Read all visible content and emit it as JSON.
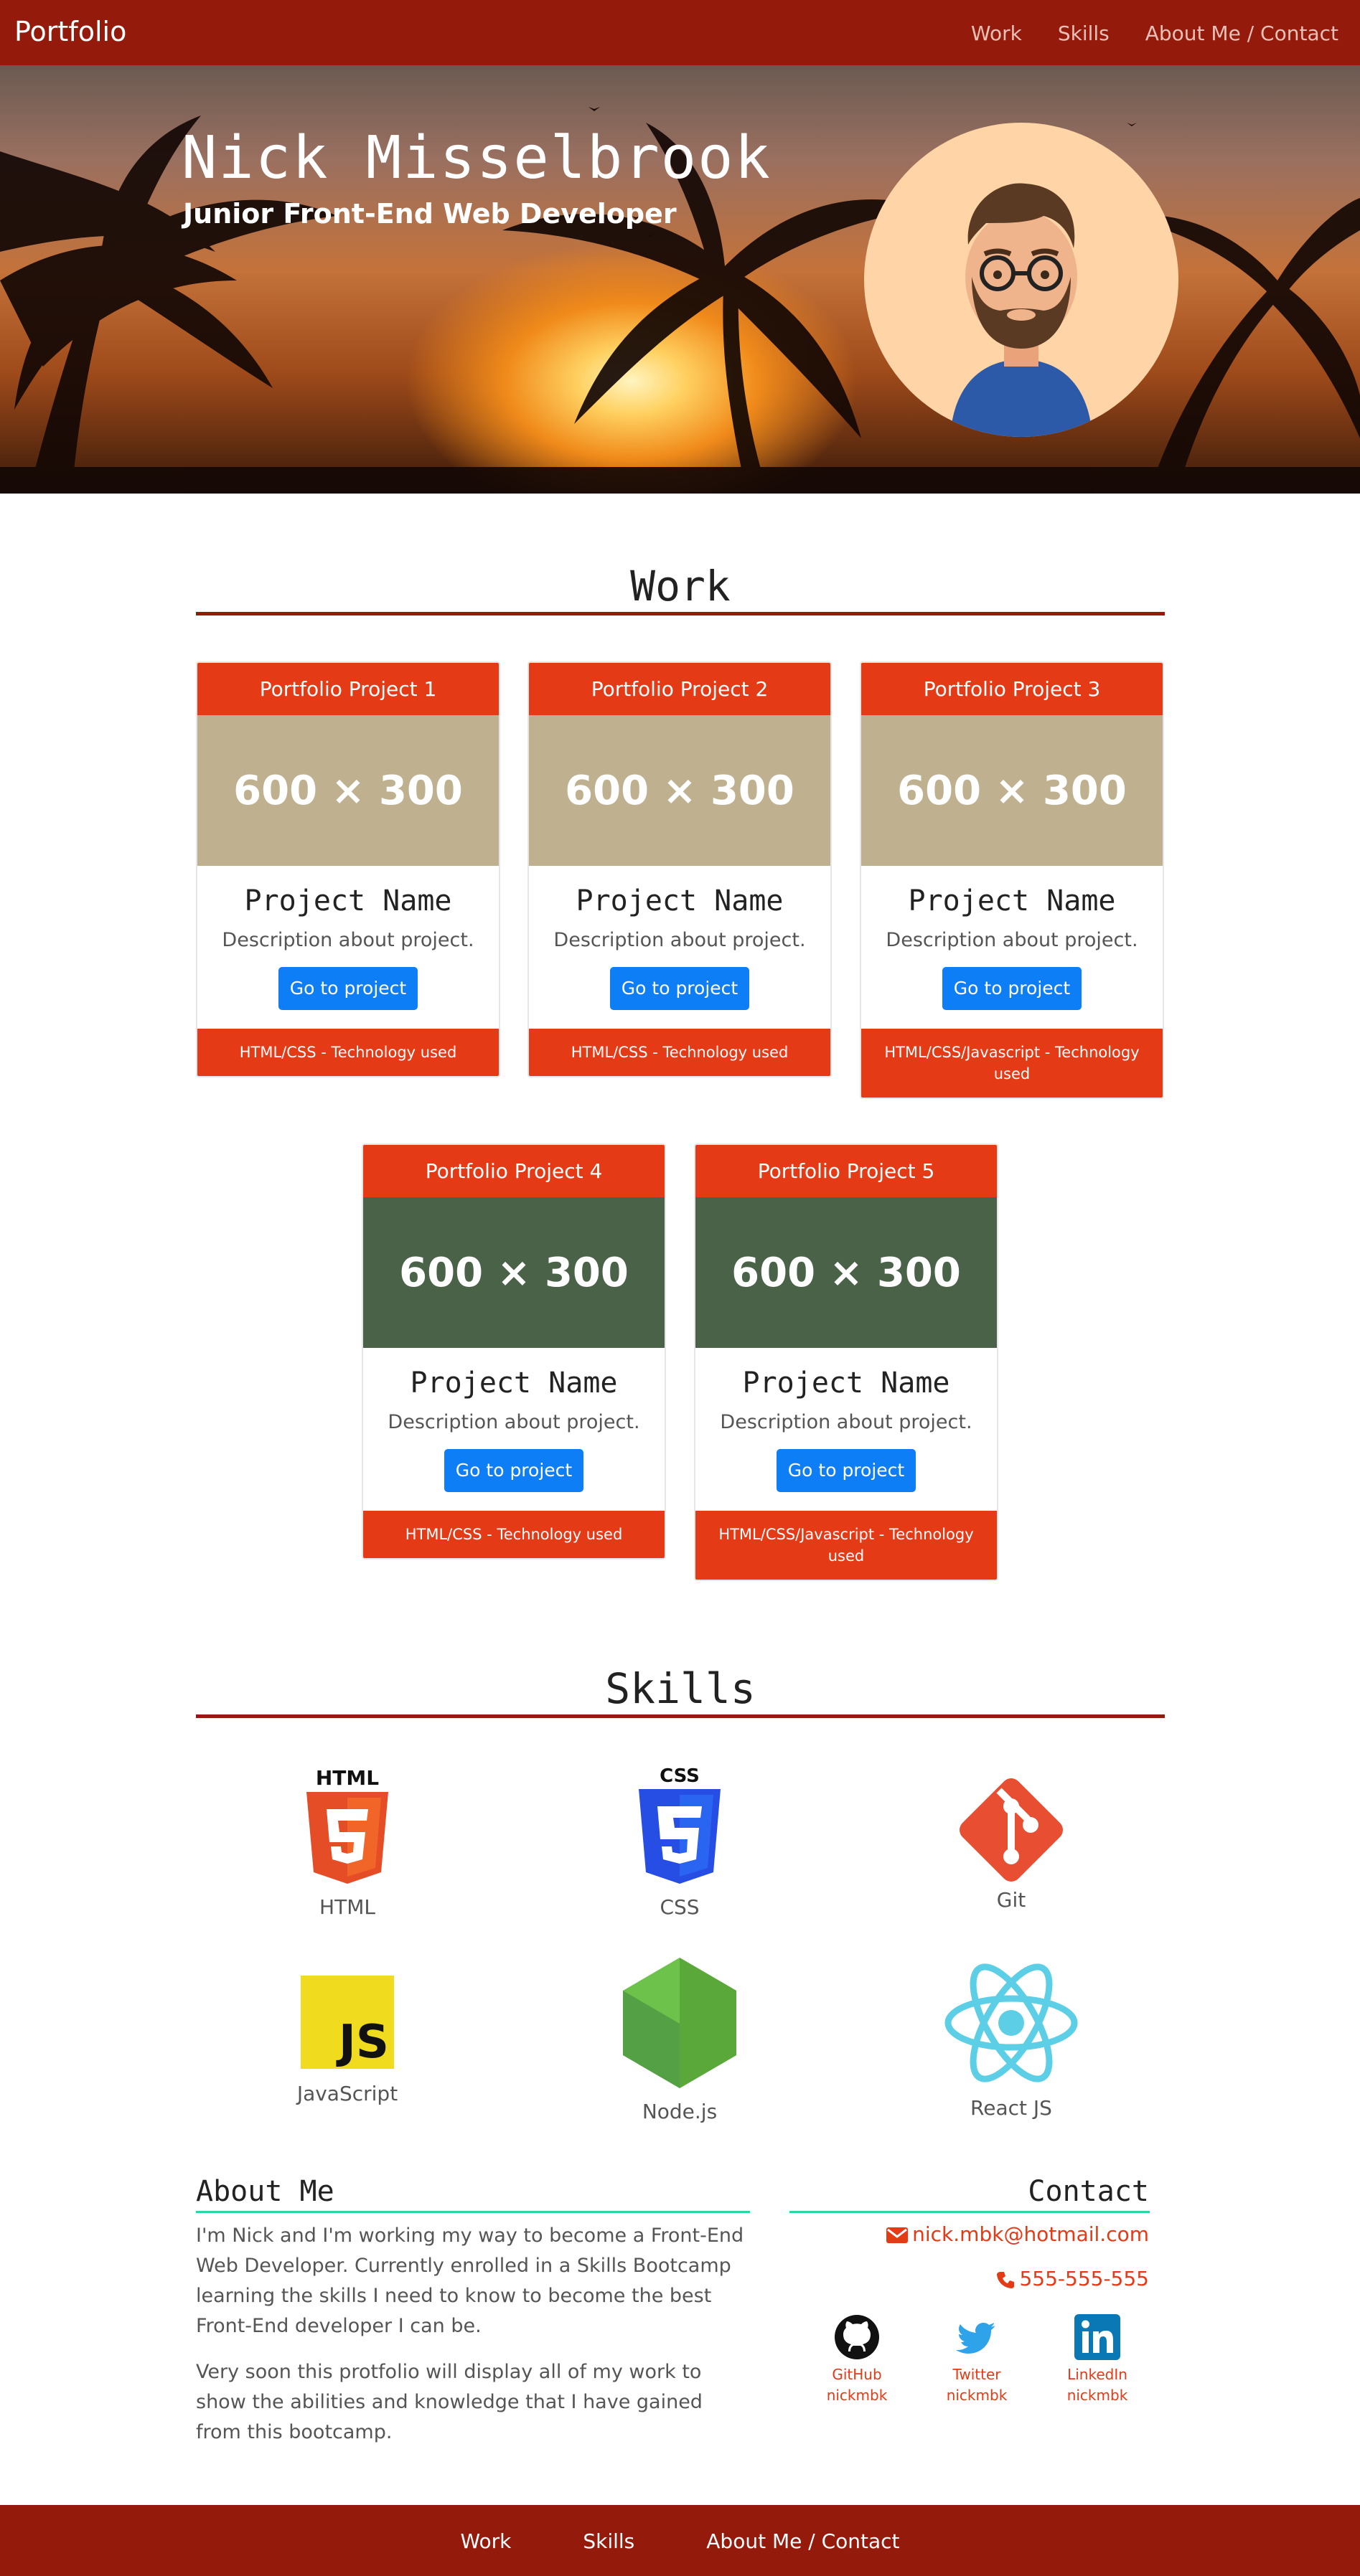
{
  "navbar": {
    "brand": "Portfolio",
    "links": [
      "Work",
      "Skills",
      "About Me / Contact"
    ]
  },
  "hero": {
    "name": "Nick Misselbrook",
    "subtitle": "Junior Front-End Web Developer"
  },
  "work": {
    "title": "Work",
    "cards": [
      {
        "header": "Portfolio Project 1",
        "image_text": "600 × 300",
        "image_color": "#bfb08f",
        "title": "Project Name",
        "description": "Description about project.",
        "button": "Go to project",
        "footer": "HTML/CSS - Technology used"
      },
      {
        "header": "Portfolio Project 2",
        "image_text": "600 × 300",
        "image_color": "#bfb08f",
        "title": "Project Name",
        "description": "Description about project.",
        "button": "Go to project",
        "footer": "HTML/CSS - Technology used"
      },
      {
        "header": "Portfolio Project 3",
        "image_text": "600 × 300",
        "image_color": "#bfb08f",
        "title": "Project Name",
        "description": "Description about project.",
        "button": "Go to project",
        "footer": "HTML/CSS/Javascript - Technology used"
      },
      {
        "header": "Portfolio Project 4",
        "image_text": "600 × 300",
        "image_color": "#4a6348",
        "title": "Project Name",
        "description": "Description about project.",
        "button": "Go to project",
        "footer": "HTML/CSS - Technology used"
      },
      {
        "header": "Portfolio Project 5",
        "image_text": "600 × 300",
        "image_color": "#4a6348",
        "title": "Project Name",
        "description": "Description about project.",
        "button": "Go to project",
        "footer": "HTML/CSS/Javascript - Technology used"
      }
    ]
  },
  "skills": {
    "title": "Skills",
    "items": [
      {
        "label": "HTML",
        "icon": "html5-icon"
      },
      {
        "label": "CSS",
        "icon": "css3-icon"
      },
      {
        "label": "Git",
        "icon": "git-icon"
      },
      {
        "label": "JavaScript",
        "icon": "javascript-icon"
      },
      {
        "label": "Node.js",
        "icon": "nodejs-icon"
      },
      {
        "label": "React JS",
        "icon": "react-icon"
      }
    ]
  },
  "about": {
    "title": "About Me",
    "paragraphs": [
      "I'm Nick and I'm working my way to become a Front-End Web Developer. Currently enrolled in a Skills Bootcamp learning the skills I need to know to become the best Front-End developer I can be.",
      "Very soon this protfolio will display all of my work to show the abilities and knowledge that I have gained from this bootcamp."
    ]
  },
  "contact": {
    "title": "Contact",
    "email": "nick.mbk@hotmail.com",
    "phone": "555-555-555",
    "socials": [
      {
        "name": "GitHub",
        "handle": "nickmbk",
        "icon": "github-icon"
      },
      {
        "name": "Twitter",
        "handle": "nickmbk",
        "icon": "twitter-icon"
      },
      {
        "name": "LinkedIn",
        "handle": "nickmbk",
        "icon": "linkedin-icon"
      }
    ]
  },
  "footer": {
    "links": [
      "Work",
      "Skills",
      "About Me / Contact"
    ]
  },
  "colors": {
    "navbar": "#941b0c",
    "card_accent": "#e53a16",
    "button": "#0d7ef5",
    "about_rule": "#26d9a4"
  }
}
